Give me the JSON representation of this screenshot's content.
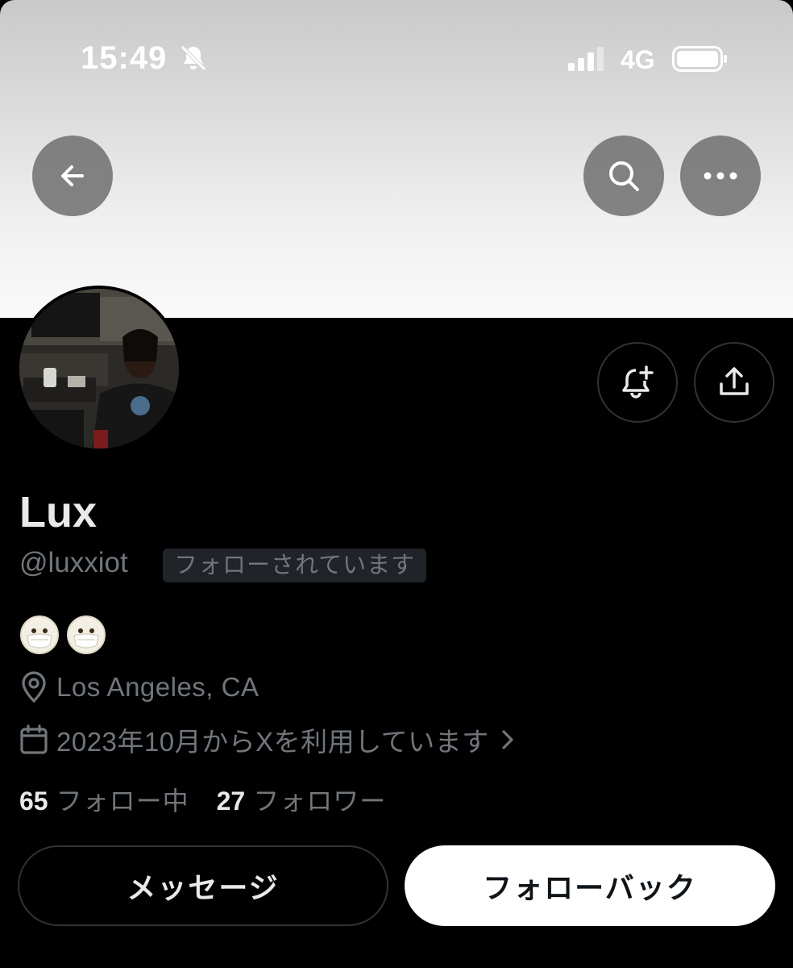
{
  "status_bar": {
    "time": "15:49",
    "network": "4G",
    "icons": [
      "bell-slash-icon",
      "cellular-signal-icon",
      "battery-icon"
    ]
  },
  "header": {
    "buttons": [
      "back-arrow-icon",
      "search-icon",
      "more-horizontal-icon"
    ]
  },
  "profile": {
    "display_name": "Lux",
    "handle": "@luxxiot",
    "follows_you_badge": "フォローされています",
    "bio_emojis": [
      "face-with-mask-emoji",
      "face-with-mask-emoji"
    ],
    "location": "Los Angeles, CA",
    "joined": "2023年10月からXを利用しています",
    "following_count": "65",
    "following_label": "フォロー中",
    "followers_count": "27",
    "followers_label": "フォロワー"
  },
  "actions": {
    "message_label": "メッセージ",
    "follow_back_label": "フォローバック",
    "icons": [
      "bell-plus-icon",
      "share-icon"
    ]
  },
  "colors": {
    "background": "#000000",
    "text_primary": "#e7e9ea",
    "text_secondary": "#71767b",
    "border": "#2f3336",
    "badge_bg": "#202327",
    "primary_button_bg": "#ffffff"
  }
}
